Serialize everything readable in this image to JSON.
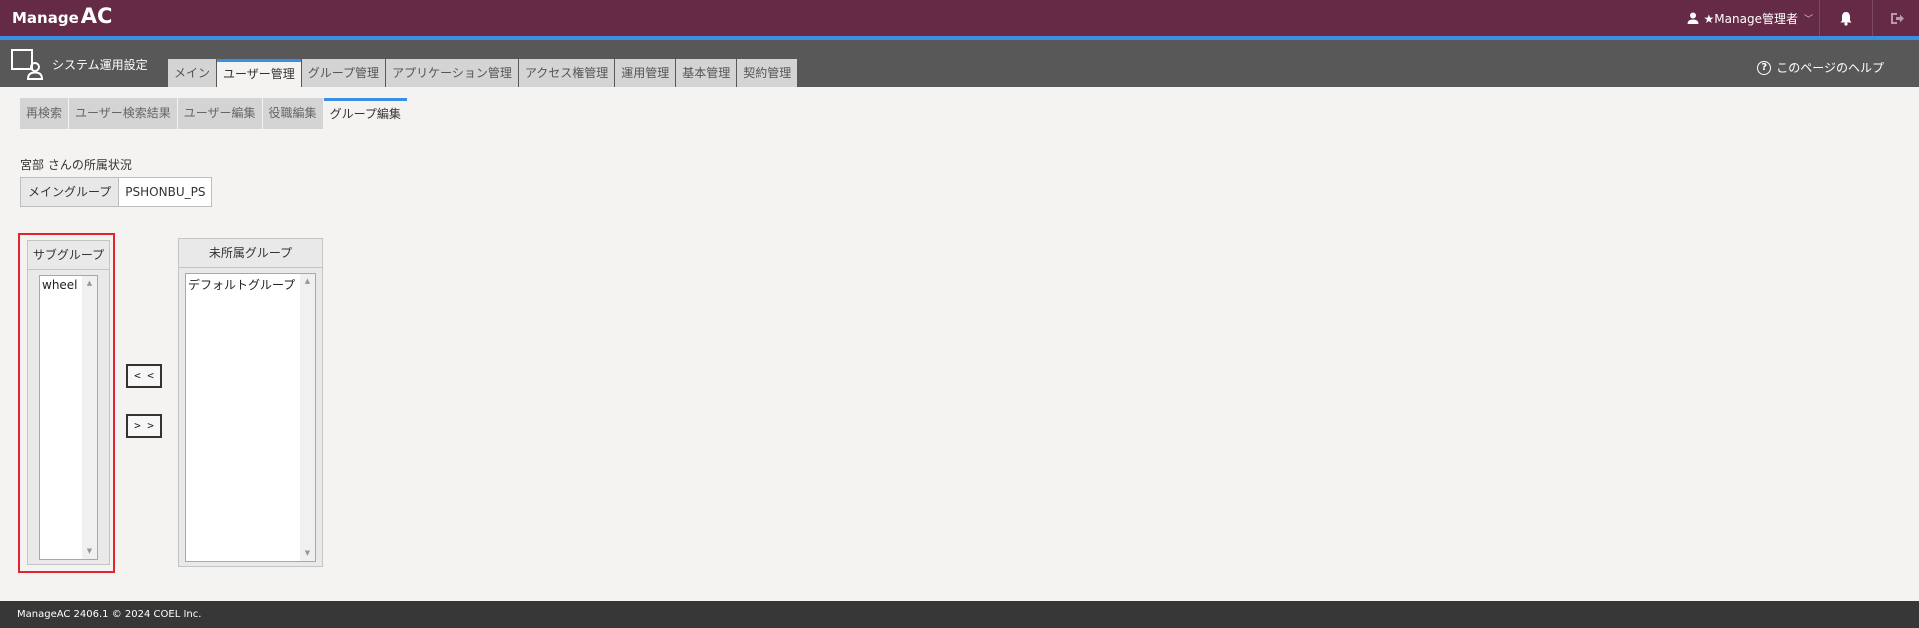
{
  "app": {
    "logo_part1": "Manage",
    "logo_part2": "AC",
    "user_label": "★Manage管理者",
    "chevron": "﹀"
  },
  "nav": {
    "section_title": "システム運用設定",
    "tabs": [
      {
        "label": "メイン",
        "active": false
      },
      {
        "label": "ユーザー管理",
        "active": true
      },
      {
        "label": "グループ管理",
        "active": false
      },
      {
        "label": "アプリケーション管理",
        "active": false
      },
      {
        "label": "アクセス権管理",
        "active": false
      },
      {
        "label": "運用管理",
        "active": false
      },
      {
        "label": "基本管理",
        "active": false
      },
      {
        "label": "契約管理",
        "active": false
      }
    ],
    "help_label": "このページのヘルプ",
    "help_symbol": "?"
  },
  "subtabs": [
    {
      "label": "再検索",
      "active": false
    },
    {
      "label": "ユーザー検索結果",
      "active": false
    },
    {
      "label": "ユーザー編集",
      "active": false
    },
    {
      "label": "役職編集",
      "active": false
    },
    {
      "label": "グループ編集",
      "active": true
    }
  ],
  "membership": {
    "status_label": "宮部 さんの所属状況",
    "main_group_label": "メイングループ",
    "main_group_value": "PSHONBU_PS"
  },
  "subgroups": {
    "title": "サブグループ",
    "items": [
      "wheel"
    ]
  },
  "unassigned": {
    "title": "未所属グループ",
    "items": [
      "デフォルトグループ"
    ]
  },
  "buttons": {
    "add_label": "< <",
    "remove_label": "> >"
  },
  "footer": {
    "text": "ManageAC 2406.1 © 2024 COEL Inc."
  },
  "colors": {
    "header_bg": "#652a45",
    "accent_blue": "#3a8fe2",
    "nav_bg": "#585858",
    "highlight_red": "#e2242c",
    "footer_bg": "#373737"
  }
}
